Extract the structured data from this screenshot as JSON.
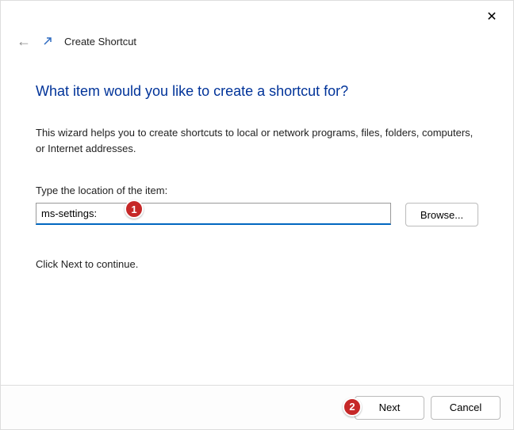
{
  "window": {
    "title": "Create Shortcut",
    "close_text": "✕"
  },
  "heading": "What item would you like to create a shortcut for?",
  "description": "This wizard helps you to create shortcuts to local or network programs, files, folders, computers, or Internet addresses.",
  "field_label": "Type the location of the item:",
  "location_value": "ms-settings:",
  "browse_label": "Browse...",
  "continue_text": "Click Next to continue.",
  "footer": {
    "next": "Next",
    "cancel": "Cancel"
  },
  "annotations": {
    "badge1": "1",
    "badge2": "2"
  }
}
